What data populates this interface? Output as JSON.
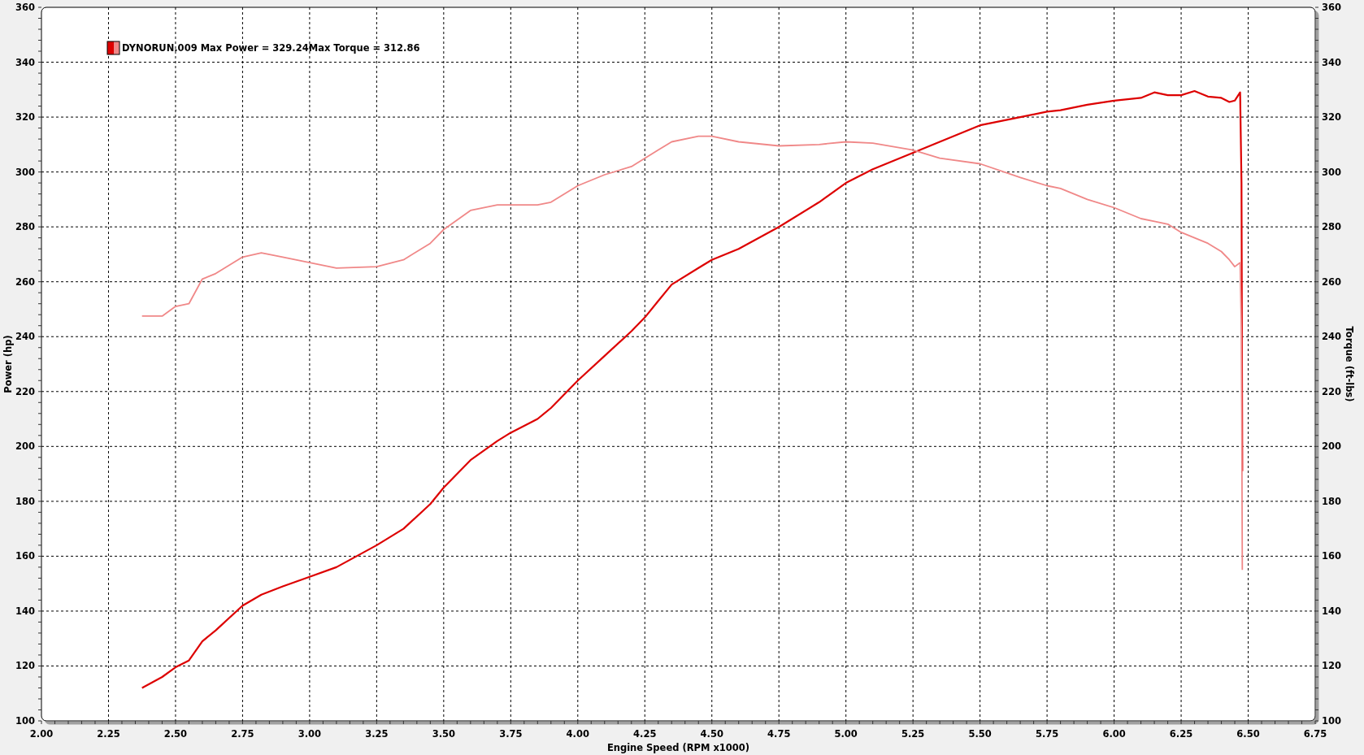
{
  "chart": {
    "legend": {
      "label": "DYNORUN.009 Max Power = 329.24Max Torque = 312.86"
    },
    "chart_data": {
      "type": "line",
      "xlabel": "Engine Speed (RPM x1000)",
      "ylabel": "Power (hp)",
      "y2label": "Torque (ft-lbs)",
      "xlim": [
        2.0,
        6.75
      ],
      "ylim": [
        100,
        360
      ],
      "y2lim": [
        100,
        360
      ],
      "grid": true,
      "xticks": [
        {
          "value": 2.0,
          "label": "2.00"
        },
        {
          "value": 2.25,
          "label": "2.25"
        },
        {
          "value": 2.5,
          "label": "2.50"
        },
        {
          "value": 2.75,
          "label": "2.75"
        },
        {
          "value": 3.0,
          "label": "3.00"
        },
        {
          "value": 3.25,
          "label": "3.25"
        },
        {
          "value": 3.5,
          "label": "3.50"
        },
        {
          "value": 3.75,
          "label": "3.75"
        },
        {
          "value": 4.0,
          "label": "4.00"
        },
        {
          "value": 4.25,
          "label": "4.25"
        },
        {
          "value": 4.5,
          "label": "4.50"
        },
        {
          "value": 4.75,
          "label": "4.75"
        },
        {
          "value": 5.0,
          "label": "5.00"
        },
        {
          "value": 5.25,
          "label": "5.25"
        },
        {
          "value": 5.5,
          "label": "5.50"
        },
        {
          "value": 5.75,
          "label": "5.75"
        },
        {
          "value": 6.0,
          "label": "6.00"
        },
        {
          "value": 6.25,
          "label": "6.25"
        },
        {
          "value": 6.5,
          "label": "6.50"
        },
        {
          "value": 6.75,
          "label": "6.75"
        }
      ],
      "yticks": [
        100,
        120,
        140,
        160,
        180,
        200,
        220,
        240,
        260,
        280,
        300,
        320,
        340,
        360
      ],
      "y2ticks": [
        100,
        120,
        140,
        160,
        180,
        200,
        220,
        240,
        260,
        280,
        300,
        320,
        340,
        360
      ],
      "x": [
        2.375,
        2.45,
        2.5,
        2.55,
        2.6,
        2.65,
        2.75,
        2.82,
        2.9,
        3.0,
        3.1,
        3.25,
        3.35,
        3.45,
        3.5,
        3.6,
        3.7,
        3.75,
        3.85,
        3.9,
        4.0,
        4.1,
        4.2,
        4.25,
        4.3,
        4.35,
        4.45,
        4.5,
        4.6,
        4.75,
        4.9,
        5.0,
        5.1,
        5.25,
        5.35,
        5.5,
        5.65,
        5.75,
        5.8,
        5.9,
        6.0,
        6.1,
        6.15,
        6.2,
        6.25,
        6.3,
        6.35,
        6.4,
        6.43,
        6.45,
        6.47,
        6.475,
        6.478
      ],
      "series": [
        {
          "color": "#dd0000",
          "values": [
            112,
            116,
            119.5,
            122,
            129,
            133,
            142,
            146,
            149,
            152.5,
            156,
            164,
            170,
            179,
            185,
            195,
            202,
            205,
            210,
            214,
            224,
            233,
            242,
            247,
            253,
            259,
            265,
            268,
            272,
            280,
            289,
            296,
            301,
            307,
            311,
            317,
            320,
            322,
            322.5,
            324.5,
            326,
            327,
            329,
            328,
            328,
            329.5,
            327.5,
            327,
            325.5,
            326,
            329,
            296,
            191
          ]
        },
        {
          "color": "#f08888",
          "values": [
            247.5,
            247.5,
            251,
            252,
            261,
            263,
            269,
            270.5,
            269,
            267,
            265,
            265.5,
            268,
            274,
            279,
            286,
            288,
            288,
            288,
            289,
            295,
            299,
            302,
            305,
            308,
            311,
            313,
            313,
            311,
            309.5,
            310,
            311,
            310.5,
            308,
            305,
            303,
            298,
            295,
            294,
            290,
            287,
            283,
            282,
            281,
            278,
            276,
            274,
            271,
            268,
            265.5,
            267,
            240,
            155
          ]
        }
      ]
    }
  }
}
